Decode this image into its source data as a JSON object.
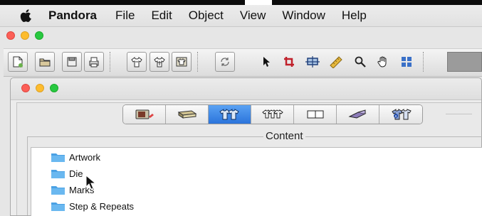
{
  "menubar": {
    "apple_icon": "apple-icon",
    "app": "Pandora",
    "items": [
      "File",
      "Edit",
      "Object",
      "View",
      "Window",
      "Help"
    ]
  },
  "toolbar": {
    "buttons": [
      {
        "icon": "new-document-icon"
      },
      {
        "icon": "open-folder-icon"
      },
      {
        "icon": "save-icon"
      },
      {
        "icon": "print-icon"
      },
      {
        "icon": "shirt-front-icon"
      },
      {
        "icon": "shirt-outline-icon"
      },
      {
        "icon": "shirt-template-icon"
      },
      {
        "icon": "refresh-icon"
      },
      {
        "icon": "arrow-pointer-icon"
      },
      {
        "icon": "crop-tool-icon"
      },
      {
        "icon": "transform-tool-icon"
      },
      {
        "icon": "ruler-icon"
      },
      {
        "icon": "magnifier-icon"
      },
      {
        "icon": "hand-icon"
      },
      {
        "icon": "grid-view-icon"
      }
    ]
  },
  "doc_window": {
    "segments": [
      {
        "icon": "artwork-tab-icon",
        "active": false
      },
      {
        "icon": "die-tab-icon",
        "active": false
      },
      {
        "icon": "shirts-tab-icon",
        "active": true
      },
      {
        "icon": "group-tab-icon",
        "active": false
      },
      {
        "icon": "layout-tab-icon",
        "active": false
      },
      {
        "icon": "tools-tab-icon",
        "active": false
      },
      {
        "icon": "info-shirt-tab-icon",
        "active": false
      }
    ],
    "content_label": "Content",
    "list_items": [
      "Artwork",
      "Die",
      "Marks",
      "Step & Repeats"
    ]
  },
  "colors": {
    "accent_blue": "#2b74db",
    "folder_blue": "#4aa1e4",
    "traffic_red": "#fc5f57",
    "traffic_yellow": "#fdbc2e",
    "traffic_green": "#28c840"
  }
}
